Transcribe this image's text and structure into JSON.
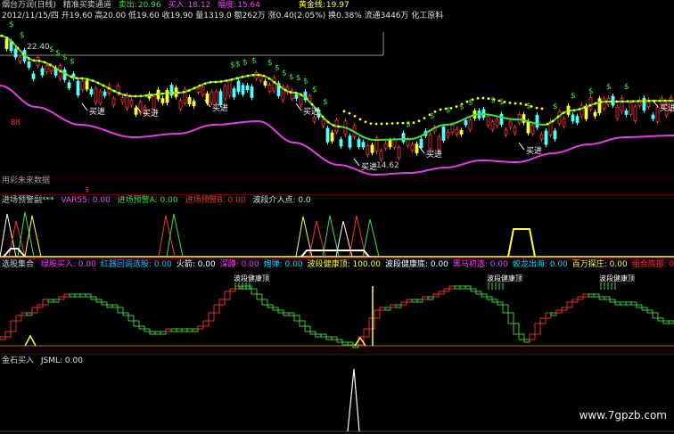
{
  "main": {
    "title_stock": "烟台万润(日线)",
    "title_indicator": "精准买卖通道",
    "sell_label": "卖出:",
    "sell_val": "20.96",
    "buy_label": "买入:",
    "buy_val": "18.12",
    "amp_label": "幅度:",
    "amp_val": "15.64",
    "gold_label": "黄金线:",
    "gold_val": "19.97",
    "quote_line": "2012/11/15/四 开19.60 高20.00 低19.60 收19.90 量1319.0 额262万 涨0.40(2.05%) 换0.38% 流通3446万 化工原料",
    "price_high": "22.40",
    "price_low": "14.62",
    "buy_signal_text": "买进",
    "sell_signal_text": "$",
    "note": "用彩朱来数据",
    "colors": {
      "up": "#ff3232",
      "down": "#54ffff",
      "upper": "#ffff00",
      "mid": "#40e040",
      "lower": "#e040e0",
      "sig": "#40e040"
    }
  },
  "panel2": {
    "title": "进场预警副***",
    "var55": "VAR55: 0.00",
    "warn1": "进场预警A: 0.00",
    "warn2": "进场预警B: 0.00",
    "wave": "波段介入点: 0.0"
  },
  "panel3": {
    "title": "选股集合",
    "items": [
      {
        "text": "绿股买入: 0.00",
        "color": "#ff40ff"
      },
      {
        "text": "红器回调选股: 0.00",
        "color": "#00c8ff"
      },
      {
        "text": "火箭: 0.00",
        "color": "#ffffff"
      },
      {
        "text": "深蹲: 0.00",
        "color": "#ff40ff"
      },
      {
        "text": "炮弹: 0.00",
        "color": "#00e0ff"
      },
      {
        "text": "波段健康顶: 100.00",
        "color": "#ffff40"
      },
      {
        "text": "波段健康底: 0.00",
        "color": "#ffffff"
      },
      {
        "text": "黑马初选: 0.00",
        "color": "#ff40ff"
      },
      {
        "text": "蛟龙出海: 0.00",
        "color": "#00e0ff"
      },
      {
        "text": "百万探庄: 0.00",
        "color": "#ffff40"
      },
      {
        "text": "组合底部: 0.00",
        "color": "#ff3030"
      }
    ],
    "tag_label": "波段健康顶"
  },
  "panel4": {
    "title": "金石买入",
    "jsml": "JSML: 0.00"
  },
  "watermark": "www.7gpzb.com"
}
